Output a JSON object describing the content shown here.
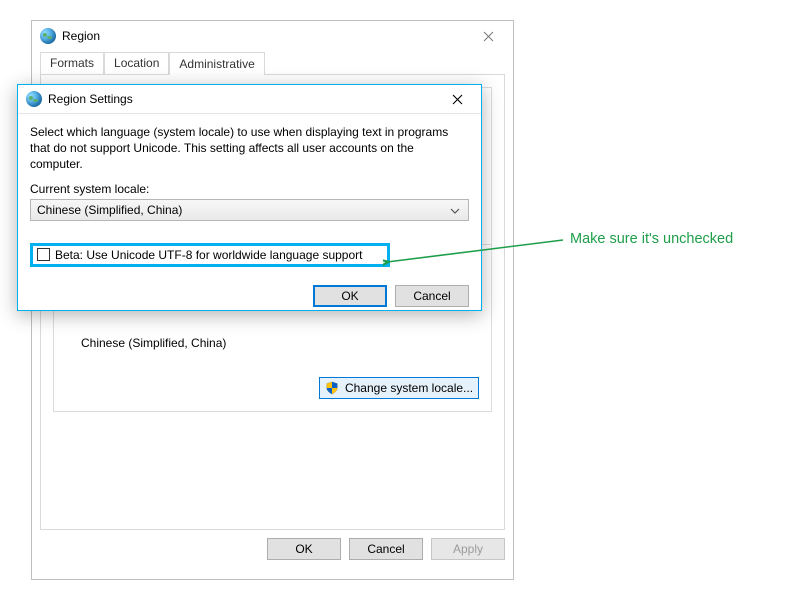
{
  "parent": {
    "title": "Region",
    "tabs": [
      "Formats",
      "Location",
      "Administrative"
    ],
    "active_tab": 2,
    "locale_value": "Chinese (Simplified, China)",
    "change_locale_btn": "Change system locale...",
    "ok": "OK",
    "cancel": "Cancel",
    "apply": "Apply"
  },
  "dialog": {
    "title": "Region Settings",
    "description": "Select which language (system locale) to use when displaying text in programs that do not support Unicode. This setting affects all user accounts on the computer.",
    "locale_label": "Current system locale:",
    "locale_value": "Chinese (Simplified, China)",
    "beta_label": "Beta: Use Unicode UTF-8 for worldwide language support",
    "beta_checked": false,
    "ok": "OK",
    "cancel": "Cancel"
  },
  "annotation": {
    "text": "Make sure it's unchecked",
    "color": "#1e9e4a"
  }
}
